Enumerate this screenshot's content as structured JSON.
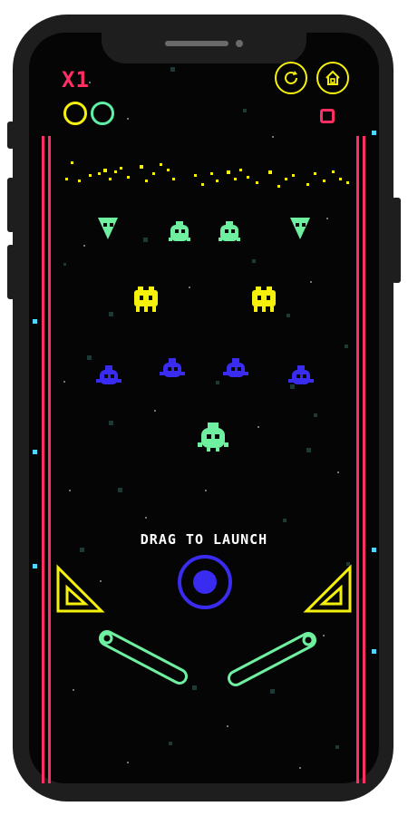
{
  "hud": {
    "multiplier": "X1",
    "lives": [
      {
        "state": "empty",
        "color": "#f5f10a"
      },
      {
        "state": "empty",
        "color": "#5ef0a6"
      }
    ],
    "restart_icon": "restart-icon",
    "home_icon": "home-icon"
  },
  "instruction": "DRAG TO LAUNCH",
  "colors": {
    "rail": "#ff2e63",
    "yellow": "#f5f10a",
    "mint": "#6ff0a0",
    "blue": "#3a2bf0",
    "edge_light": "#4fd8ff"
  },
  "enemies": {
    "row1": [
      "triangle-ship",
      "round-alien",
      "round-alien",
      "triangle-ship"
    ],
    "row2": [
      "crab-alien",
      "crab-alien"
    ],
    "row3": [
      "blue-alien",
      "blue-alien",
      "blue-alien",
      "blue-alien"
    ],
    "row4": [
      "round-alien"
    ]
  }
}
